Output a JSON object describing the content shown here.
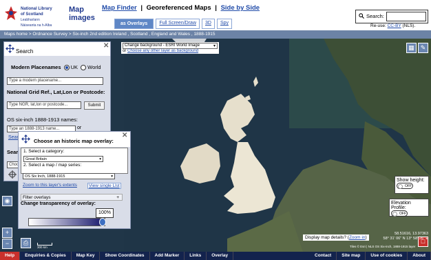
{
  "header": {
    "org_name_line1": "National Library",
    "org_name_line2": "of Scotland",
    "org_gaelic_line1": "Leabharlann",
    "org_gaelic_line2": "Nàiseanta na h-Alba",
    "site_title_line1": "Map",
    "site_title_line2": "images",
    "nav_map_finder": "Map Finder",
    "nav_sep": "|",
    "nav_current": "Georeferenced Maps",
    "nav_side_by_side": "Side by Side",
    "view_overlays": "as Overlays",
    "view_fullscreen": "Full Screen/Draw",
    "view_3d": "3D",
    "view_spy": "Spy",
    "search_label": "Search:",
    "reuse_prefix": "Re-use:",
    "reuse_link": "CC-BY",
    "reuse_suffix": "(NLS)."
  },
  "breadcrumb": "Maps home  >  Ordnance Survey  >  Six-inch 2nd edition Ireland , Scotland , England and Wales , 1888-1915",
  "background": {
    "selected": "Change background - ESRI World Image",
    "or": "or",
    "link": "Choose any other layer as background"
  },
  "search_panel": {
    "title": "Search",
    "modern_placenames": "Modern Placenames",
    "opt_uk": "UK",
    "opt_world": "World",
    "placename_placeholder": "Type a modern placename...",
    "ngr_label": "National Grid Ref., Lat,Lon or Postcode:",
    "ngr_placeholder": "Type NGR, lat,lon or postcode...",
    "submit": "Submit",
    "six_inch_label": "OS six-inch 1888-1913 names:",
    "six_inch_placeholder": "Type an 1888-1913 name...",
    "or": "or",
    "trunc_search": "Sear",
    "trunc_s2": "Searc",
    "trunc_choose": "Choo"
  },
  "overlay_panel": {
    "title": "Choose an historic map overlay:",
    "step1": "1. Select a category:",
    "category": "Great Britain",
    "step2": "2. Select a map / map series:",
    "series": "OS Six Inch, 1888-1915",
    "zoom_link": "Zoom to this layer's extents",
    "view_link": "View single Llst",
    "filter": "Filter overlays",
    "filter_plus": "+",
    "transparency_label": "Change transparency of overlay:",
    "transparency_value": "100%",
    "transparency_fraction": 1.0
  },
  "right_controls": {
    "show_height": "Show height:",
    "show_height_state": "OFF",
    "elevation_profile": "Elevation Profile:",
    "elevation_state": "OFF"
  },
  "map_info": {
    "details_text": "Display map details? (",
    "zoom_link": "Zoom in",
    "details_close": ")",
    "coord_decimal": "58.51616, 13.97363",
    "coord_dms": "58° 31' 06\" N 13° 58' 26\" E",
    "attribution": "Tiles © Esri | NLS OS Six-inch, 1888-1915 layer",
    "scale": "300 km"
  },
  "footer": {
    "help": "Help",
    "enquiries": "Enquiries & Copies",
    "map_key": "Map Key",
    "show_coordinates": "Show Coordinates",
    "add_marker": "Add Marker",
    "links": "Links",
    "overlay": "Overlay",
    "contact": "Contact",
    "site_map": "Site map",
    "use_of_cookies": "Use of cookies",
    "about": "About"
  },
  "colors": {
    "nls_blue": "#213a8f",
    "footer_bg": "#13234d",
    "help_red": "#c9302c",
    "breadcrumb_bg": "#6c83a6",
    "sea": "#1d3244",
    "land": "#e9e3d2"
  }
}
